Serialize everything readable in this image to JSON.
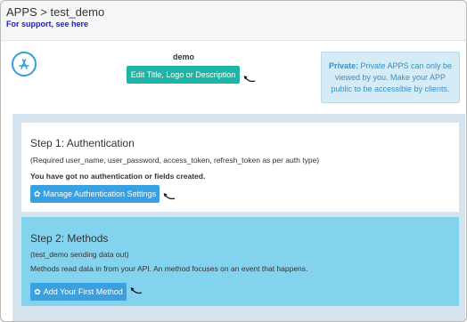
{
  "header": {
    "breadcrumb": "APPS > test_demo",
    "support_link": "For support, see here"
  },
  "app": {
    "name": "demo",
    "icon": "app-store-icon",
    "edit_button_label": "Edit Title, Logo or Description"
  },
  "private_note": {
    "title": "Private:",
    "text": "Private APPS can only be viewed by you. Make your APP public to be accessible by clients."
  },
  "authentication": {
    "title": "Step 1: Authentication",
    "subtitle": "(Required user_name, user_password, access_token, refresh_token as per auth type)",
    "status": "You have got no authentication or fields created.",
    "button_label": "Manage Authentication Settings",
    "button_icon": "gear-icon"
  },
  "methods": {
    "title": "Step 2: Methods",
    "subtitle": "(test_demo sending data out)",
    "description": "Methods read data in from your API. An method focuses on an event that happens.",
    "button_label": "Add Your First Method",
    "button_icon": "gear-icon"
  },
  "colors": {
    "teal": "#1fb5a6",
    "blue": "#3aa0e0",
    "methods_bg": "#84d3ee",
    "content_bg": "#d6e4f0",
    "note_bg": "#d5ecf7"
  }
}
